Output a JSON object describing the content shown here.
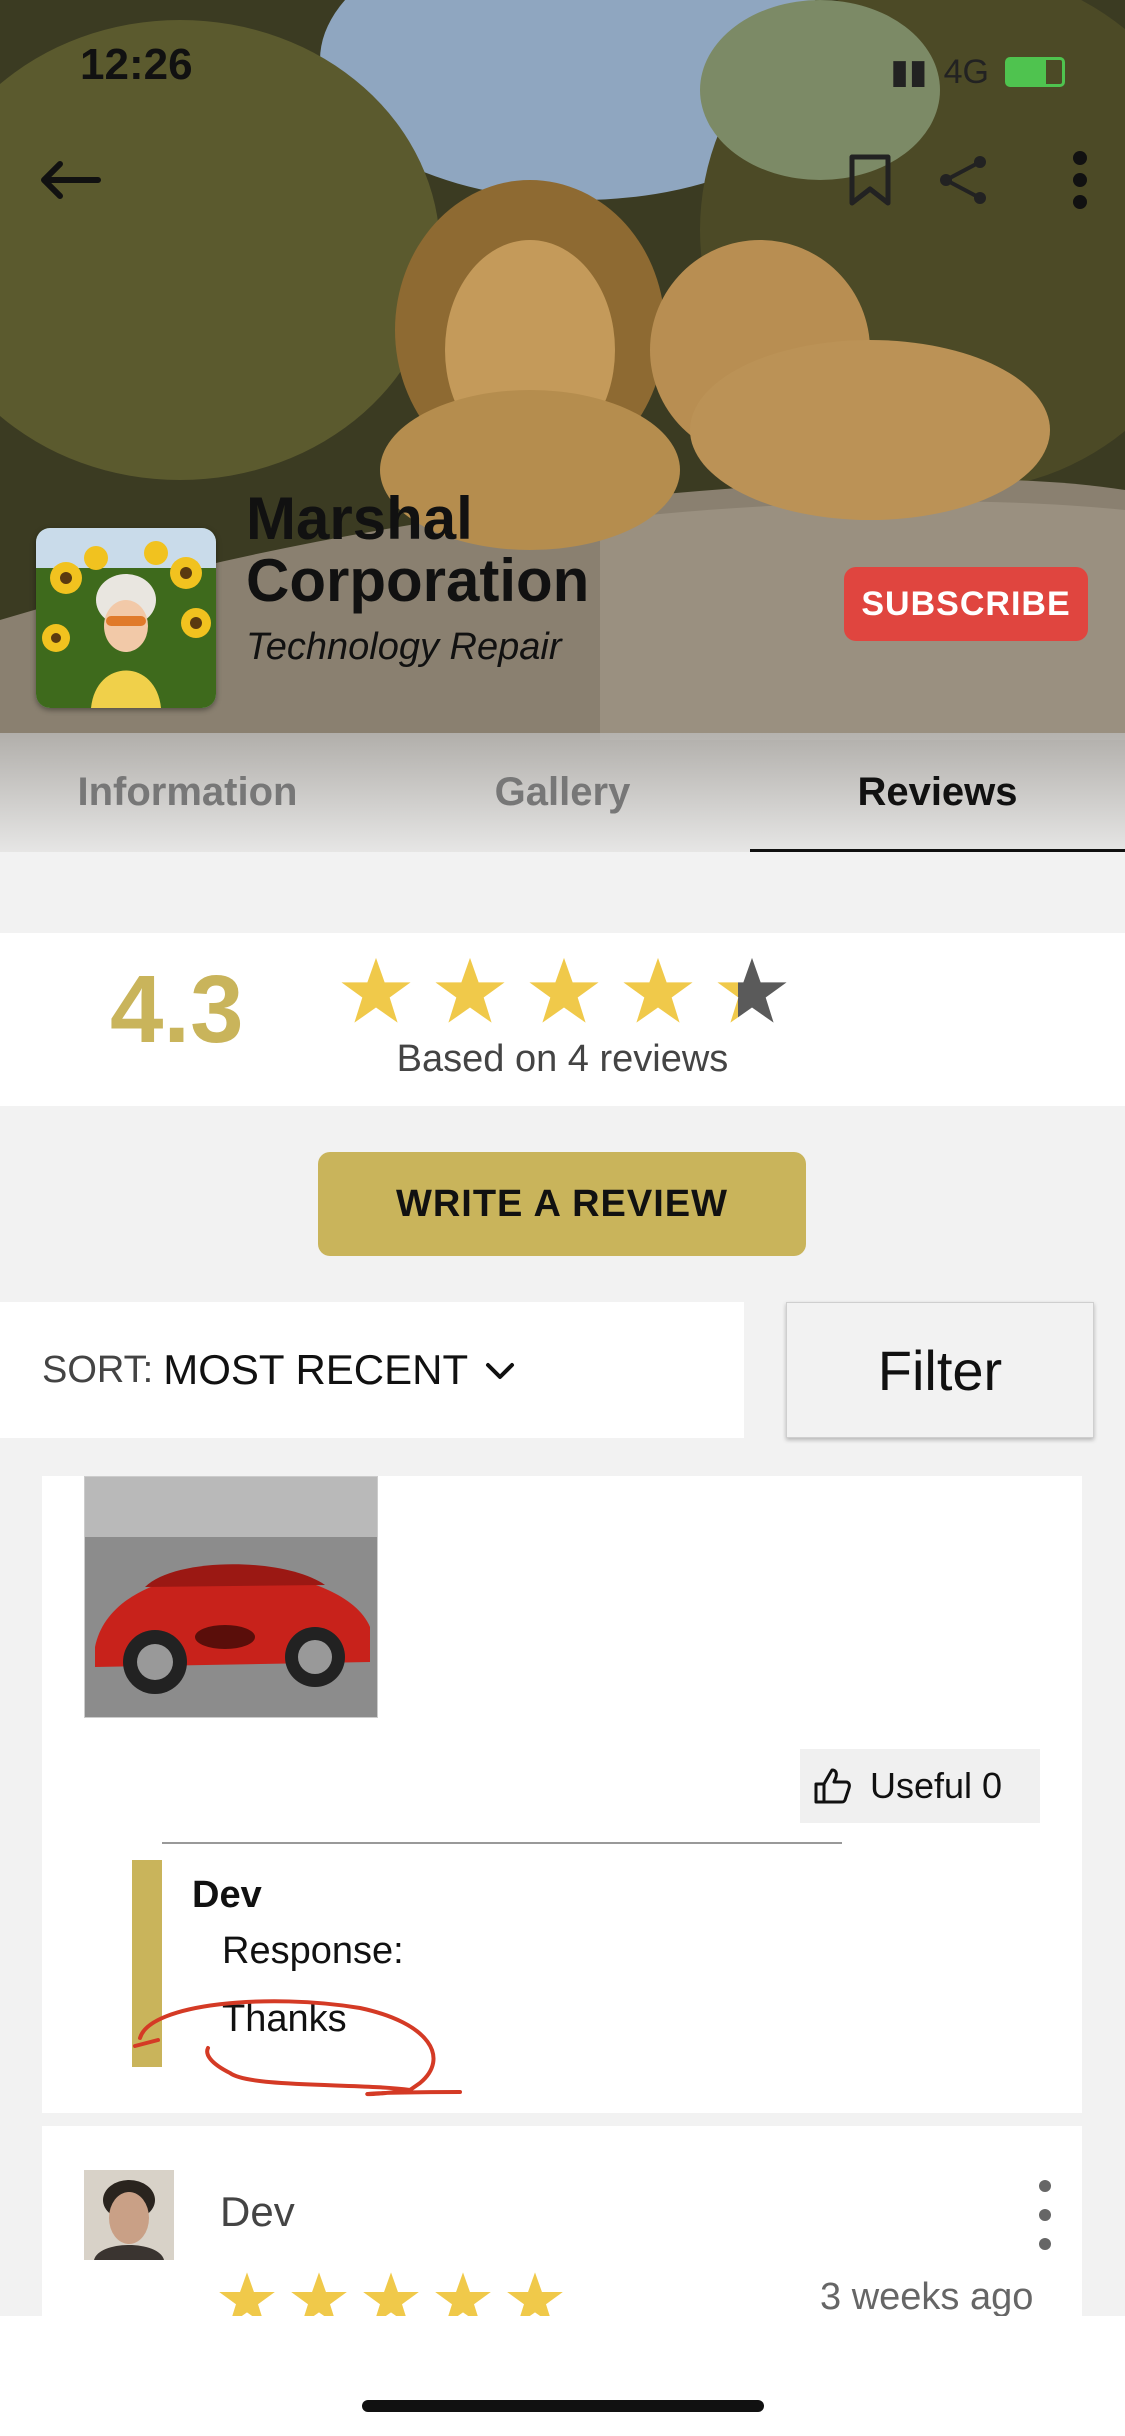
{
  "status_bar": {
    "time": "12:26",
    "network": "4G"
  },
  "header": {
    "company_name": "Marshal Corporation",
    "category": "Technology Repair",
    "subscribe_label": "SUBSCRIBE"
  },
  "tabs": [
    {
      "label": "Information",
      "active": false
    },
    {
      "label": "Gallery",
      "active": false
    },
    {
      "label": "Reviews",
      "active": true
    }
  ],
  "rating": {
    "value": "4.3",
    "stars": 4.3,
    "count_text": "Based on 4 reviews"
  },
  "actions": {
    "write_review_label": "WRITE A REVIEW",
    "sort_label": "SORT:",
    "sort_value": "MOST RECENT",
    "filter_label": "Filter"
  },
  "reviews": [
    {
      "useful_label": "Useful 0",
      "response": {
        "author": "Dev",
        "label": "Response:",
        "text": "Thanks"
      }
    },
    {
      "author": "Dev",
      "stars": 5,
      "time": "3 weeks ago"
    }
  ],
  "colors": {
    "accent_gold": "#c9b45b",
    "subscribe_red": "#e0453f",
    "star_gold": "#f0c94a",
    "star_empty": "#5a5a5a"
  },
  "icons": {
    "back": "arrow-left-icon",
    "bookmark": "bookmark-icon",
    "share": "share-icon",
    "more": "more-vertical-icon",
    "useful": "thumbs-up-icon",
    "sort": "chevron-down-icon"
  }
}
